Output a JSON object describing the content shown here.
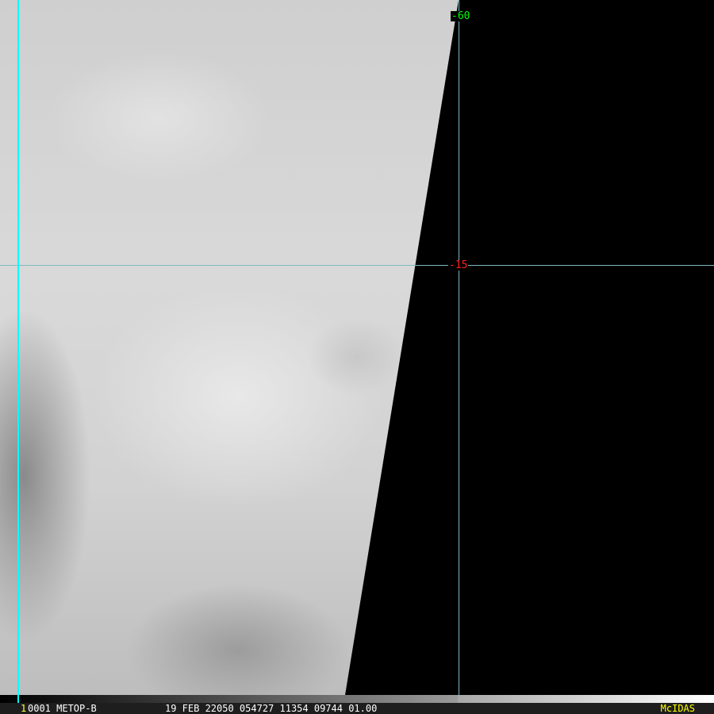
{
  "image": {
    "type": "satellite-visible-imagery",
    "dark_region": "#000000"
  },
  "grid": {
    "lat_label": "-15",
    "lon_label": "-60",
    "lat_color": "#ff2020",
    "lon_color": "#00ff00",
    "line_color": "#7fb8c0"
  },
  "footer": {
    "frame_number": "1",
    "sat_info": "0001 METOP-B",
    "meta": "19 FEB 22050 054727 11354 09744 01.00",
    "brand": "McIDAS",
    "brand_color": "#ffff00"
  }
}
